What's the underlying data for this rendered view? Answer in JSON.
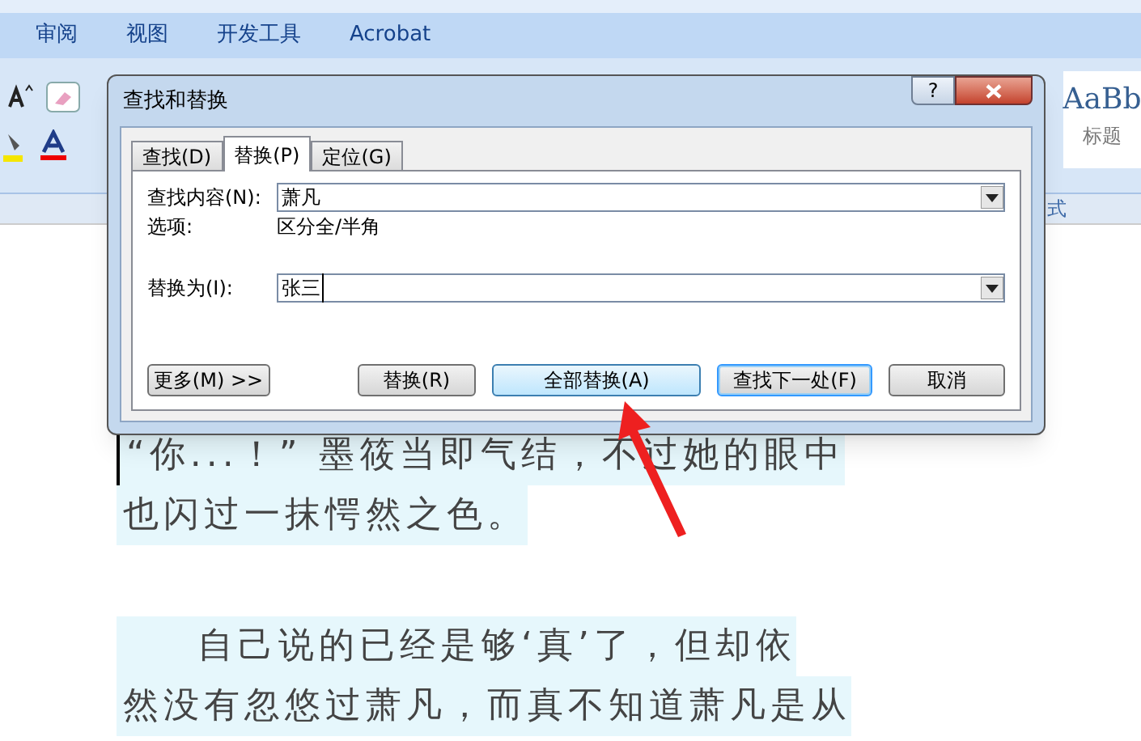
{
  "ribbon": {
    "tabs": [
      {
        "label": "审阅",
        "selected": false
      },
      {
        "label": "视图",
        "selected": false
      },
      {
        "label": "开发工具",
        "selected": false
      },
      {
        "label": "Acrobat",
        "selected": false
      }
    ],
    "style_sample": "AaBb",
    "style_caption": "标题",
    "group_label": "式"
  },
  "dialog": {
    "title": "查找和替换",
    "help": "?",
    "tabs": [
      {
        "label": "查找(D)",
        "selected": false
      },
      {
        "label": "替换(P)",
        "selected": true
      },
      {
        "label": "定位(G)",
        "selected": false
      }
    ],
    "find": {
      "label": "查找内容(N):",
      "value": "萧凡"
    },
    "options": {
      "label": "选项:",
      "value": "区分全/半角"
    },
    "replace": {
      "label": "替换为(I):",
      "value": "张三"
    },
    "buttons": [
      {
        "label": "更多(M) >>",
        "kind": "normal"
      },
      {
        "label": "替换(R)",
        "kind": "normal"
      },
      {
        "label": "全部替换(A)",
        "kind": "hover"
      },
      {
        "label": "查找下一处(F)",
        "kind": "default"
      },
      {
        "label": "取消",
        "kind": "normal"
      }
    ]
  },
  "document": {
    "paragraphs": [
      {
        "first_line_indent": false,
        "lines": [
          "“你...！” 墨筱当即气结，不过她的眼中",
          "也闪过一抹愕然之色。"
        ]
      },
      {
        "first_line_indent": true,
        "lines": [
          "自己说的已经是够‘真’了，但却依",
          "然没有忽悠过萧凡，而真不知道萧凡是从"
        ]
      }
    ]
  }
}
